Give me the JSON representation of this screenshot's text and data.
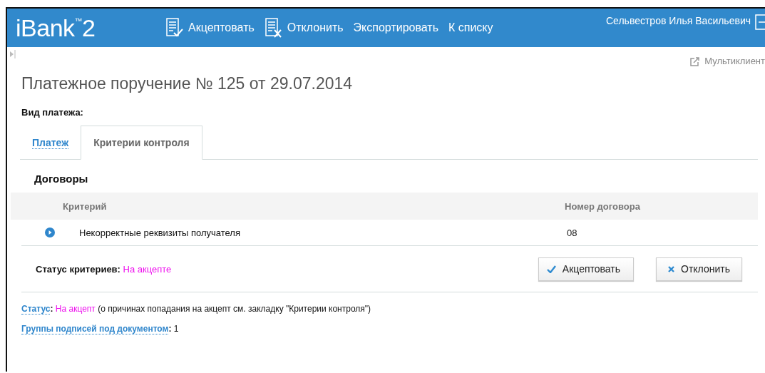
{
  "header": {
    "logo": "iBank$^{™}$2",
    "user": "Сельвестров Илья Васильевич",
    "actions": [
      {
        "kind": "accept",
        "label": "Акцептовать"
      },
      {
        "kind": "reject",
        "label": "Отклонить"
      },
      {
        "kind": "text",
        "label": "Экспортировать"
      },
      {
        "kind": "text",
        "label": "К списку"
      }
    ]
  },
  "multiclient": "Мультиклиент",
  "title": "Платежное поручение № 125 от 29.07.2014",
  "payment_type_label": "Вид платежа:",
  "tabs": [
    {
      "label": "Платеж",
      "selected": false
    },
    {
      "label": "Критерии контроля",
      "selected": true
    }
  ],
  "section": "Договоры",
  "table": {
    "columns": [
      "Критерий",
      "Номер договора"
    ],
    "rows": [
      {
        "criterion": "Некорректные реквизиты получателя",
        "contract": "08"
      }
    ]
  },
  "criteria_status": {
    "label": "Статус критериев:",
    "value": "На акцепте"
  },
  "buttons": [
    {
      "kind": "accept",
      "label": "Акцептовать"
    },
    {
      "kind": "reject",
      "label": "Отклонить"
    }
  ],
  "status": {
    "link": "Статус",
    "colon": ":",
    "value": "На акцепт",
    "note": "(о причинах попадания на акцепт см. закладку \"Критерии контроля\")"
  },
  "signature_groups": {
    "link": "Группы подписей под документом",
    "colon": ":",
    "value": "1"
  }
}
